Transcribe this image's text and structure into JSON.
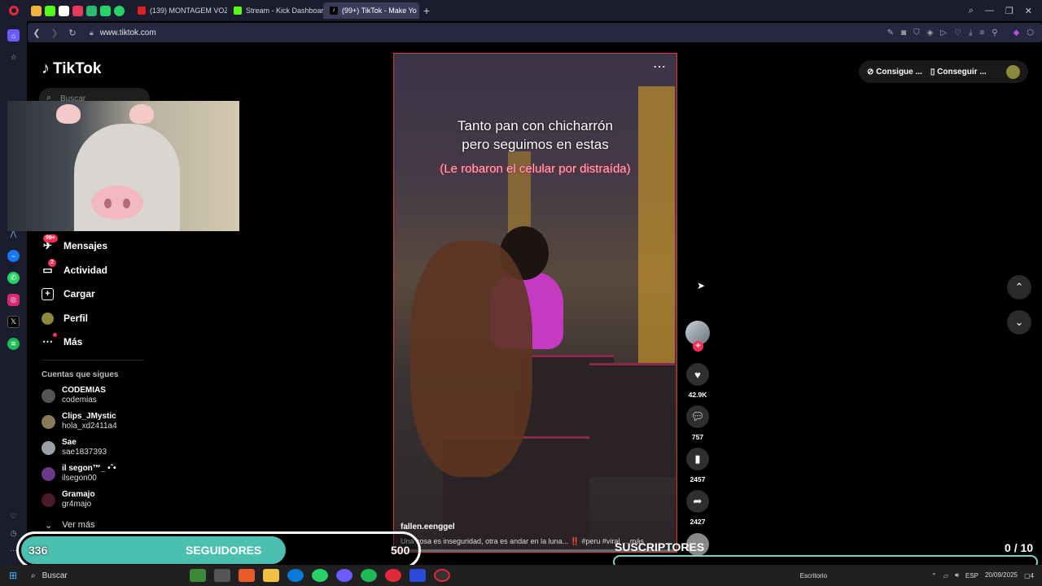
{
  "browser": {
    "tabs": [
      {
        "label": "(139) MONTAGEM VOZES",
        "color": "#e02020"
      },
      {
        "label": "Stream - Kick Dashboard",
        "color": "#53fc18"
      },
      {
        "label": "(99+) TikTok - Make Yo",
        "color": "#ffffff",
        "active": true
      }
    ],
    "url": "www.tiktok.com"
  },
  "tiktok": {
    "logo": "TikTok",
    "search_placeholder": "Buscar",
    "nav": [
      {
        "label": "Mensajes",
        "badge": "99+",
        "icon": "paper-plane-icon"
      },
      {
        "label": "Actividad",
        "badge": "2",
        "icon": "message-icon"
      },
      {
        "label": "Cargar",
        "icon": "plus-square-icon"
      },
      {
        "label": "Perfil",
        "icon": "avatar-icon"
      },
      {
        "label": "Más",
        "icon": "more-icon"
      }
    ],
    "following_title": "Cuentas que sigues",
    "following": [
      {
        "name": "CODEMIAS",
        "handle": "codemias",
        "color": "#555555"
      },
      {
        "name": "Clips_JMystic",
        "handle": "hola_xd2411a4",
        "color": "#8a7a5a"
      },
      {
        "name": "Sae",
        "handle": "sae1837393",
        "color": "#9aa0a8"
      },
      {
        "name": "il segon™_ •ˆ•",
        "handle": "ilsegon00",
        "color": "#6a3a8a"
      },
      {
        "name": "Gramajo",
        "handle": "gr4majo",
        "color": "#4a1a2a"
      }
    ],
    "see_more": "Ver más",
    "top_buttons": [
      "Consigue ...",
      "Conseguir ..."
    ]
  },
  "video": {
    "caption_line1": "Tanto pan con chicharrón",
    "caption_line2": "pero seguimos en estas",
    "caption_red": "(Le robaron el celular por distraída)",
    "author": "fallen.eenggel",
    "description": "Una cosa es inseguridad, otra es andar en la luna... ‼️ #peru  #viral ... más",
    "progress": 0.04,
    "likes": "42.9K",
    "comments": "757",
    "saves": "2457",
    "shares": "2427"
  },
  "overlay": {
    "followers_current": "336",
    "followers_label": "SEGUIDORES",
    "followers_goal": "500",
    "followers_progress": 0.672,
    "subs_label": "SUSCRIPTORES",
    "subs_count": "0",
    "subs_goal": "/ 10"
  },
  "taskbar": {
    "search": "Buscar",
    "desktop_label": "Escritorio",
    "lang": "ESP",
    "date": "20/09/2025",
    "notifications": "4"
  }
}
